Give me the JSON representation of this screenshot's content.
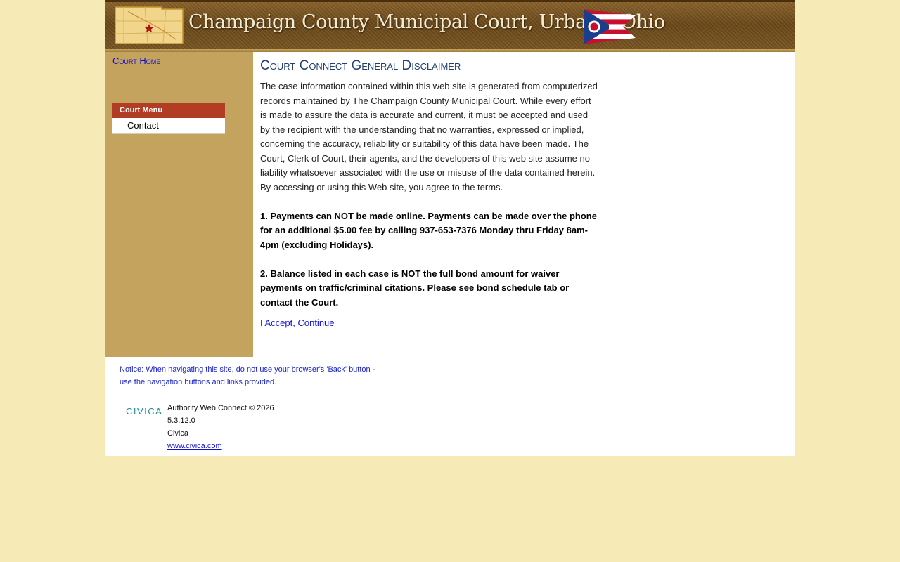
{
  "header": {
    "title": "Champaign County Municipal Court, Urbana, Ohio",
    "county_map_icon": "county-map-icon",
    "flag_icon": "ohio-flag-icon"
  },
  "sidebar": {
    "court_home_link": "Court Home",
    "menu": {
      "header": "Court Menu",
      "items": [
        {
          "label": "Contact"
        }
      ]
    }
  },
  "main": {
    "heading": "Court Connect General Disclaimer",
    "paragraph": "The case information contained within this web site is generated from computerized records maintained by The Champaign County Municipal Court. While every effort is made to assure the data is accurate and current, it must be accepted and used by the recipient with the understanding that no warranties, expressed or implied, concerning the accuracy, reliability or suitability of this data have been made. The Court, Clerk of Court, their agents, and the developers of this web site assume no liability whatsoever associated with the use or misuse of the data contained herein. By accessing or using this Web site, you agree to the terms.",
    "notice_1": "1. Payments can NOT be made online. Payments can be made over the phone for an additional $5.00 fee by calling 937-653-7376 Monday thru Friday 8am-4pm (excluding Holidays).",
    "notice_2": "2. Balance listed in each case is NOT the full bond amount for waiver payments on traffic/criminal citations. Please see bond schedule tab or contact the Court.",
    "accept_link": "I Accept, Continue"
  },
  "footer": {
    "notice": "Notice: When navigating this site, do not use your browser's 'Back' button - use the navigation buttons and links provided.",
    "logo_text": "CIVICA",
    "product": "Authority Web Connect © 2026",
    "version": "5.3.12.0",
    "company": "Civica",
    "website": "www.civica.com"
  },
  "colors": {
    "page_background": "#f6eab6",
    "sidebar": "#c4a35f",
    "menu_header": "#b13d25",
    "heading": "#20406e",
    "link": "#1010d0",
    "notice": "#1a24c8",
    "logo": "#1e8e9e"
  }
}
